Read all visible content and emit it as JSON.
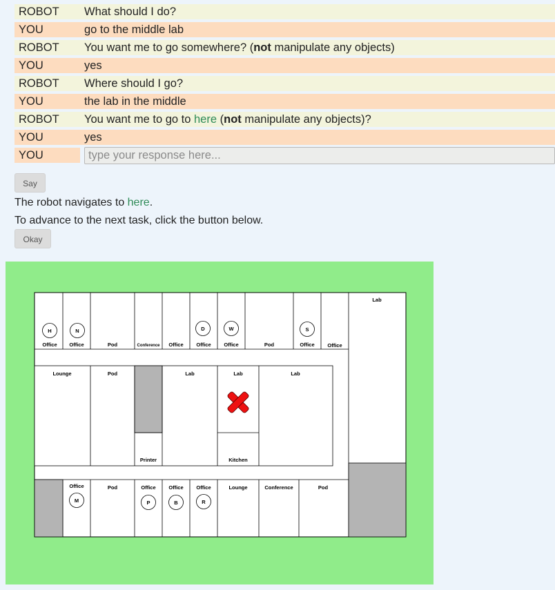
{
  "dialog": [
    {
      "speaker": "ROBOT",
      "text": "What should I do?"
    },
    {
      "speaker": "YOU",
      "text": "go to the middle lab"
    },
    {
      "speaker": "ROBOT",
      "parts": [
        "You want me to go somewhere? (",
        "not",
        " manipulate any objects)"
      ]
    },
    {
      "speaker": "YOU",
      "text": "yes"
    },
    {
      "speaker": "ROBOT",
      "text": "Where should I go?"
    },
    {
      "speaker": "YOU",
      "text": "the lab in the middle"
    },
    {
      "speaker": "ROBOT",
      "parts": [
        "You want me to go to ",
        "here",
        " (",
        "not",
        " manipulate any objects)?"
      ]
    },
    {
      "speaker": "YOU",
      "text": "yes"
    }
  ],
  "input": {
    "speaker": "YOU",
    "placeholder": "type your response here...",
    "value": ""
  },
  "say_button": "Say",
  "status": {
    "prefix": "The robot navigates to ",
    "link": "here",
    "suffix": "."
  },
  "instruction": "To advance to the next task, click the button below.",
  "okay_button": "Okay",
  "map": {
    "colors": {
      "background": "#90ec8a",
      "grey_room": "#b4b4b4",
      "target": "#ee1111"
    },
    "top_rooms": [
      "Office",
      "Office",
      "Pod",
      "Conference",
      "Office",
      "Office",
      "Office",
      "Pod",
      "Office",
      "Office"
    ],
    "top_markers": [
      "H",
      "N",
      "D",
      "W",
      "S"
    ],
    "right_room": "Lab",
    "middle_rooms": [
      "Lounge",
      "Pod",
      "Lab",
      "Lab",
      "Lab"
    ],
    "middle_bottom_rooms": [
      "Printer",
      "Kitchen"
    ],
    "bottom_rooms": [
      "Office",
      "Pod",
      "Office",
      "Office",
      "Office",
      "Lounge",
      "Conference",
      "Pod"
    ],
    "bottom_markers": [
      "M",
      "P",
      "B",
      "R"
    ],
    "target_icon": "x-mark-icon"
  }
}
